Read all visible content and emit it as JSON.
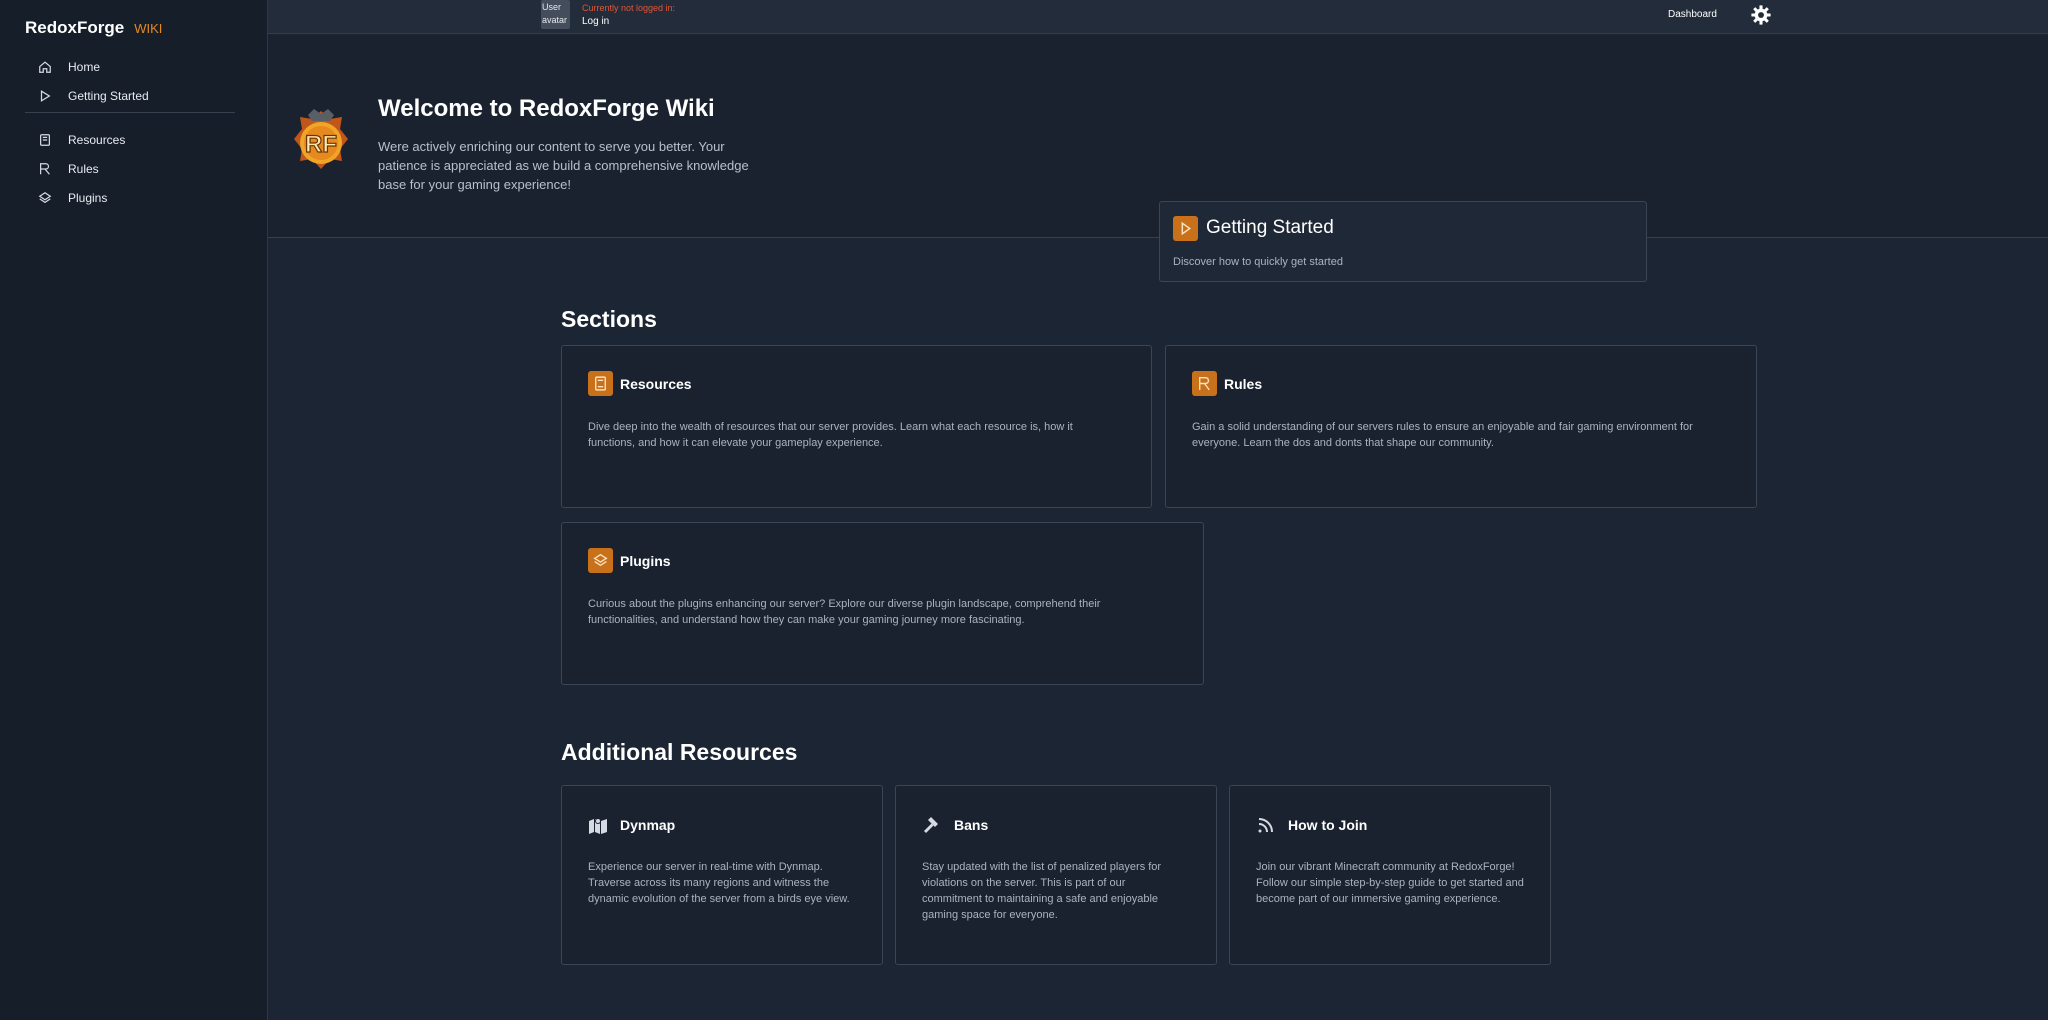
{
  "brand": {
    "name": "RedoxForge",
    "tag": "WIKI"
  },
  "nav": {
    "items": [
      {
        "label": "Home",
        "icon": "home-icon"
      },
      {
        "label": "Getting Started",
        "icon": "play-icon"
      },
      {
        "label": "Resources",
        "icon": "book-icon"
      },
      {
        "label": "Rules",
        "icon": "rules-icon"
      },
      {
        "label": "Plugins",
        "icon": "layers-icon"
      }
    ]
  },
  "topbar": {
    "avatar_alt": "User avatar",
    "login_status": "Currently not logged in:",
    "login_link": "Log in",
    "dashboard": "Dashboard"
  },
  "hero": {
    "title": "Welcome to RedoxForge Wiki",
    "description": "Were actively enriching our content to serve you better. Your patience is appreciated as we build a comprehensive knowledge base for your gaming experience!",
    "logo_text": "RF"
  },
  "getting_started": {
    "title": "Getting Started",
    "description": "Discover how to quickly get started"
  },
  "sections": {
    "heading": "Sections",
    "cards": [
      {
        "title": "Resources",
        "description": "Dive deep into the wealth of resources that our server provides. Learn what each resource is, how it functions, and how it can elevate your gameplay experience."
      },
      {
        "title": "Rules",
        "description": "Gain a solid understanding of our servers rules to ensure an enjoyable and fair gaming environment for everyone. Learn the dos and donts that shape our community."
      },
      {
        "title": "Plugins",
        "description": "Curious about the plugins enhancing our server? Explore our diverse plugin landscape, comprehend their functionalities, and understand how they can make your gaming journey more fascinating."
      }
    ]
  },
  "additional": {
    "heading": "Additional Resources",
    "cards": [
      {
        "title": "Dynmap",
        "description": "Experience our server in real-time with Dynmap. Traverse across its many regions and witness the dynamic evolution of the server from a birds eye view."
      },
      {
        "title": "Bans",
        "description": "Stay updated with the list of penalized players for violations on the server. This is part of our commitment to maintaining a safe and enjoyable gaming space for everyone."
      },
      {
        "title": "How to Join",
        "description": "Join our vibrant Minecraft community at RedoxForge! Follow our simple step-by-step guide to get started and become part of our immersive gaming experience."
      }
    ]
  },
  "colors": {
    "accent": "#e68a1f",
    "badge": "#c9711a",
    "background": "#1c2533",
    "sidebar": "#161e2a",
    "error_text": "#e0563a"
  }
}
